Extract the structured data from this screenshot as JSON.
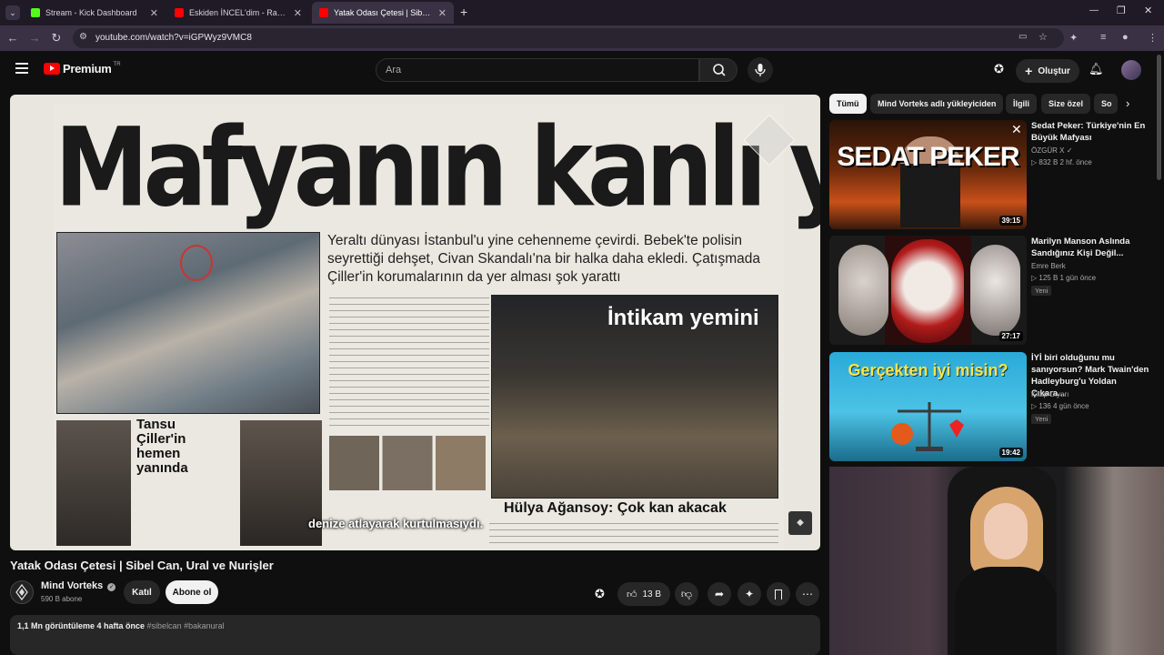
{
  "browser": {
    "tabs": [
      {
        "title": "Stream - Kick Dashboard",
        "close": "✕",
        "favicon_color": "#53fc18"
      },
      {
        "title": "Eskiden İNCEL'dim - Rahatsız Ed",
        "close": "✕",
        "favicon_color": "#ff0000"
      },
      {
        "title": "Yatak Odası Çetesi | Sibel Ca",
        "close": "✕",
        "favicon_color": "#ff0000"
      }
    ],
    "new_tab": "+",
    "url": "youtube.com/watch?v=iGPWyz9VMC8"
  },
  "header": {
    "logo_text": "Premium",
    "logo_region": "TR",
    "search_placeholder": "Ara",
    "create_label": "Oluştur"
  },
  "video": {
    "newspaper_headline": "Mafyanın kanlı yüzü",
    "newspaper_lede": "Yeraltı dünyası İstanbul'u yine cehenneme çevirdi. Bebek'te polisin seyrettiği dehşet, Civan Skandalı'na bir halka daha ekledi. Çatışmada Çiller'in korumalarının da yer alması şok yarattı",
    "newspaper_subhead_1": "İntikam yemini",
    "newspaper_subhead_2": "Tansu Çiller'in hemen yanında",
    "newspaper_subhead_3": "Hülya Ağansoy: Çok kan akacak",
    "subtitle": "denize atlayarak kurtulmasıydı."
  },
  "info": {
    "title": "Yatak Odası Çetesi | Sibel Can, Ural ve Nurişler",
    "channel": "Mind Vorteks",
    "subscribers": "590 B abone",
    "join_label": "Katıl",
    "subscribe_label": "Abone ol",
    "likes": "13 B",
    "desc_views": "1,1 Mn görüntüleme  4 hafta önce",
    "desc_tags": "#sibelcan #bakanural"
  },
  "sidebar": {
    "chips": [
      "Tümü",
      "Mind Vorteks adlı yükleyiciden",
      "İlgili",
      "Size özel",
      "So"
    ],
    "recs": [
      {
        "title": "Sedat Peker: Türkiye'nin En Büyük Mafyası",
        "channel": "ÖZGÜR X",
        "meta": "▷ 832 B  2 hf. önce",
        "duration": "39:15",
        "thumb_text": "SEDAT PEKER",
        "badge": ""
      },
      {
        "title": "Marilyn Manson Aslında Sandığınız Kişi Değil...",
        "channel": "Emre Berk",
        "meta": "▷ 125 B  1 gün önce",
        "duration": "27:17",
        "thumb_text": "",
        "badge": "Yeni"
      },
      {
        "title": "İYİ biri olduğunu mu sanıyorsun? Mark Twain'den Hadleyburg'u Yoldan Çıkara...",
        "channel": "Kitap Diyarı",
        "meta": "▷ 136  4 gün önce",
        "duration": "19:42",
        "thumb_text": "Gerçekten iyi misin?",
        "badge": "Yeni"
      }
    ]
  }
}
